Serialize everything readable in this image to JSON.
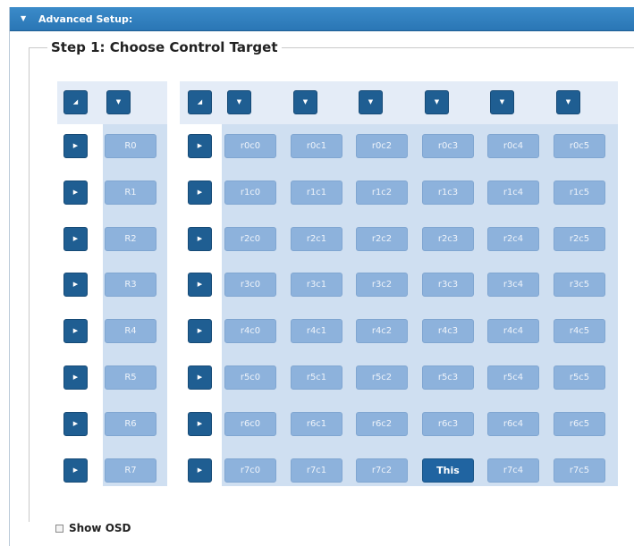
{
  "panel": {
    "title": "Advanced Setup:"
  },
  "step": {
    "title": "Step 1: Choose Control Target"
  },
  "row_labels": [
    "R0",
    "R1",
    "R2",
    "R3",
    "R4",
    "R5",
    "R6",
    "R7"
  ],
  "cells": [
    [
      "r0c0",
      "r0c1",
      "r0c2",
      "r0c3",
      "r0c4",
      "r0c5"
    ],
    [
      "r1c0",
      "r1c1",
      "r1c2",
      "r1c3",
      "r1c4",
      "r1c5"
    ],
    [
      "r2c0",
      "r2c1",
      "r2c2",
      "r2c3",
      "r2c4",
      "r2c5"
    ],
    [
      "r3c0",
      "r3c1",
      "r3c2",
      "r3c3",
      "r3c4",
      "r3c5"
    ],
    [
      "r4c0",
      "r4c1",
      "r4c2",
      "r4c3",
      "r4c4",
      "r4c5"
    ],
    [
      "r5c0",
      "r5c1",
      "r5c2",
      "r5c3",
      "r5c4",
      "r5c5"
    ],
    [
      "r6c0",
      "r6c1",
      "r6c2",
      "r6c3",
      "r6c4",
      "r6c5"
    ],
    [
      "r7c0",
      "r7c1",
      "r7c2",
      "This",
      "r7c4",
      "r7c5"
    ]
  ],
  "selected": {
    "row": 7,
    "col": 3
  },
  "icons": {
    "collapse": "triangle-down-icon",
    "corner": "corner-select-icon",
    "column": "chevron-down-icon",
    "row": "chevron-right-icon"
  },
  "osd": {
    "label": "Show OSD",
    "checked": false
  },
  "colors": {
    "header": "#2a76b5",
    "button": "#1f5e92",
    "cell": "#8db2dc",
    "cell_selected": "#2064a1",
    "grid_bg": "#cfdff1",
    "header_bg": "#e4ecf7"
  }
}
